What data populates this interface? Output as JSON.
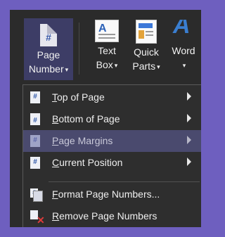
{
  "ribbon": {
    "page_number": {
      "line1": "Page",
      "line2": "Number",
      "icon_glyph": "#",
      "icon": "page-number-icon"
    },
    "text_box": {
      "line1": "Text",
      "line2": "Box",
      "icon_glyph": "A",
      "icon": "text-box-icon"
    },
    "quick_parts": {
      "line1": "Quick",
      "line2": "Parts",
      "icon": "quick-parts-icon"
    },
    "wordart": {
      "line1": "Word",
      "icon_glyph": "A",
      "icon": "wordart-icon"
    }
  },
  "menu": {
    "items": [
      {
        "label": "Top of Page",
        "accel": "T",
        "rest": "op of Page",
        "icon": "page-top-icon",
        "icon_glyph": "#",
        "submenu": true
      },
      {
        "label": "Bottom of Page",
        "accel": "B",
        "rest": "ottom of Page",
        "icon": "page-bottom-icon",
        "icon_glyph": "#",
        "submenu": true
      },
      {
        "label": "Page Margins",
        "accel": "P",
        "rest": "age Margins",
        "icon": "page-margins-icon",
        "icon_glyph": "#",
        "submenu": true,
        "highlighted": true
      },
      {
        "label": "Current Position",
        "accel": "C",
        "rest": "urrent Position",
        "icon": "current-position-icon",
        "icon_glyph": "#",
        "submenu": true
      },
      {
        "label": "Format Page Numbers...",
        "accel": "F",
        "rest": "ormat Page Numbers...",
        "icon": "format-page-numbers-icon",
        "icon_glyph": "#"
      },
      {
        "label": "Remove Page Numbers",
        "accel": "R",
        "rest": "emove Page Numbers",
        "icon": "remove-page-numbers-icon",
        "icon_glyph": "✕"
      }
    ]
  },
  "colors": {
    "background": "#6e5fbf",
    "panel": "#2b2b2b",
    "active": "#3d3d66",
    "highlight": "#4a4a6e"
  }
}
